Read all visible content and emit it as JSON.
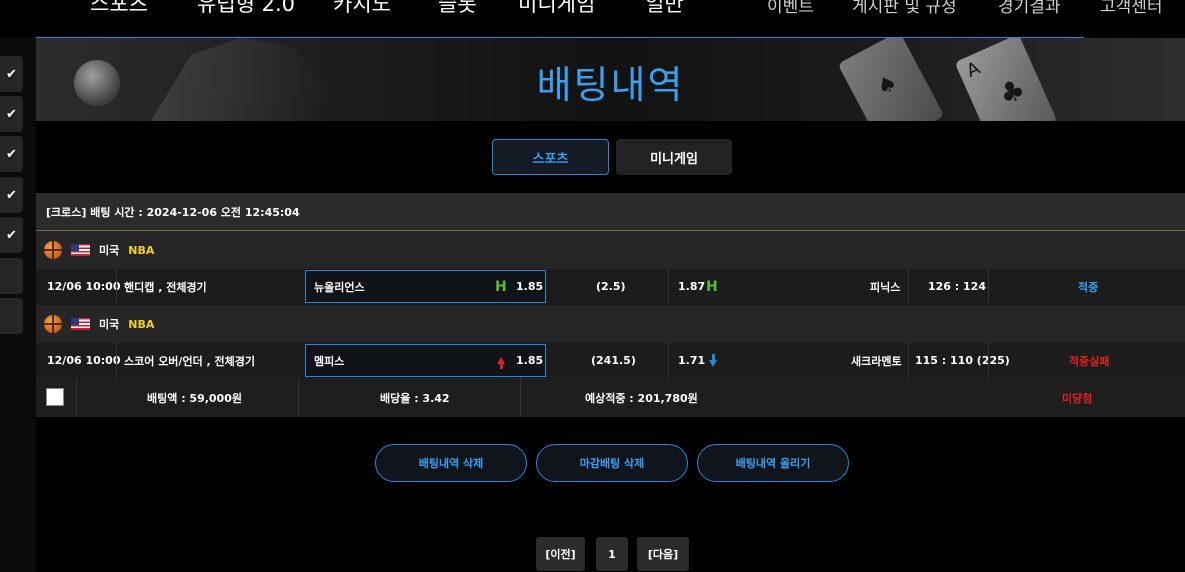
{
  "topnav": {
    "left_items": [
      "스포츠",
      "유럽형 2.0",
      "카지노",
      "슬롯",
      "미니게임",
      "일반"
    ],
    "right_items": [
      "이벤트",
      "게시판 및 규정",
      "경기결과",
      "고객센터"
    ]
  },
  "sidebar": {
    "buttons": [
      {
        "checked": true
      },
      {
        "checked": true
      },
      {
        "checked": true
      },
      {
        "checked": true
      },
      {
        "checked": true
      },
      {
        "checked": false
      },
      {
        "checked": false
      }
    ]
  },
  "banner": {
    "title": "배팅내역"
  },
  "tabs": {
    "sports": "스포츠",
    "minigame": "미니게임",
    "active": "sports"
  },
  "bet": {
    "header": "[크로스] 배팅 시간 : 2024-12-06 오전 12:45:04",
    "games": [
      {
        "league": {
          "country": "미국",
          "name": "NBA",
          "flag": "US",
          "sport_icon": "basketball-icon"
        },
        "time": "12/06 10:00",
        "market": "핸디캡 , 전체경기",
        "home": "뉴올리언스",
        "home_icon": "H",
        "home_odds": "1.85",
        "line": "(2.5)",
        "away_odds": "1.87",
        "away_icon": "H",
        "away": "피닉스",
        "score": "126 : 124",
        "result": "적중",
        "result_color": "#3aa0f0"
      },
      {
        "league": {
          "country": "미국",
          "name": "NBA",
          "flag": "US",
          "sport_icon": "basketball-icon"
        },
        "time": "12/06 10:00",
        "market": "스코어 오버/언더 , 전체경기",
        "home": "멤피스",
        "home_icon": "arrow-up",
        "home_odds": "1.85",
        "line": "(241.5)",
        "away_odds": "1.71",
        "away_icon": "arrow-down",
        "away": "새크라멘토",
        "score": "115 : 110 (225)",
        "result": "적중실패",
        "result_color": "#e02020"
      }
    ],
    "summary": {
      "amount": "배팅액 : 59,000원",
      "odds": "배당율 : 3.42",
      "expected": "예상적중 : 201,780원",
      "status": "미당첨"
    }
  },
  "actions": [
    "배팅내역 삭제",
    "마감배팅 삭제",
    "배팅내역 올리기"
  ],
  "pagination": {
    "prev": "[이전]",
    "page": "1",
    "next": "[다음]"
  },
  "colors": {
    "accent": "#2a86d8",
    "league_name": "#f2d21a",
    "win": "#3aa0f0",
    "lose": "#e02020",
    "h_icon": "#5ac02a"
  }
}
